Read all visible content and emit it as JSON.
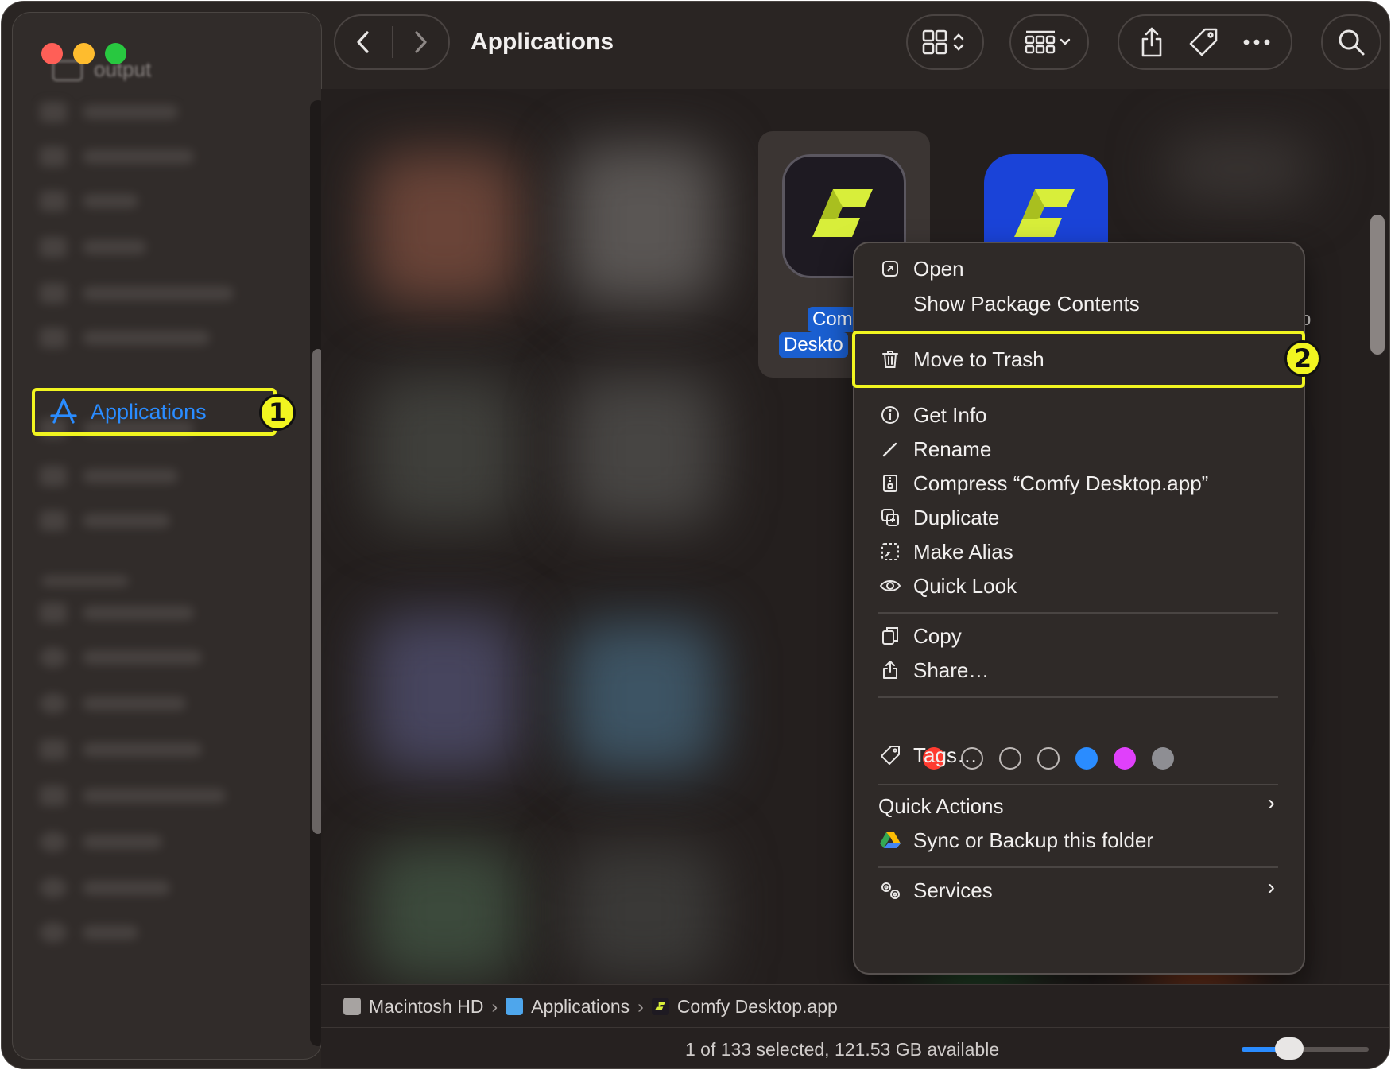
{
  "window": {
    "title": "Applications",
    "sidebar_header_blurred": "output"
  },
  "sidebar": {
    "selected_item": {
      "label": "Applications",
      "icon": "app-store-a-icon"
    },
    "annotation_1": "1"
  },
  "toolbar": {
    "back_icon": "chevron-left-icon",
    "forward_icon": "chevron-right-icon",
    "view_icon": "grid-view-icon",
    "group_icon": "group-by-icon",
    "share_icon": "share-icon",
    "tag_icon": "tag-icon",
    "more_icon": "ellipsis-icon",
    "search_icon": "search-icon"
  },
  "main": {
    "selected_app_label_line1": "Com",
    "selected_app_label_line2": "Deskto",
    "partial_label": "p"
  },
  "context_menu": {
    "open": "Open",
    "show_package_contents": "Show Package Contents",
    "move_to_trash": "Move to Trash",
    "annotation_2": "2",
    "get_info": "Get Info",
    "rename": "Rename",
    "compress": "Compress “Comfy Desktop.app”",
    "duplicate": "Duplicate",
    "make_alias": "Make Alias",
    "quick_look": "Quick Look",
    "copy": "Copy",
    "share": "Share…",
    "tags": "Tags…",
    "quick_actions": "Quick Actions",
    "sync_backup": "Sync or Backup this folder",
    "services": "Services",
    "tag_colors": [
      "#ff3b30",
      "none",
      "none",
      "none",
      "#2a8cff",
      "#e040fb",
      "#8e8e93"
    ]
  },
  "pathbar": {
    "disk": "Macintosh HD",
    "folder": "Applications",
    "file": "Comfy Desktop.app",
    "separator": "›"
  },
  "status": {
    "text": "1 of 133 selected, 121.53 GB available"
  },
  "colors": {
    "highlight": "#f1f520",
    "accent": "#2a8cff",
    "comfy_yellow": "#d8ee3a"
  }
}
